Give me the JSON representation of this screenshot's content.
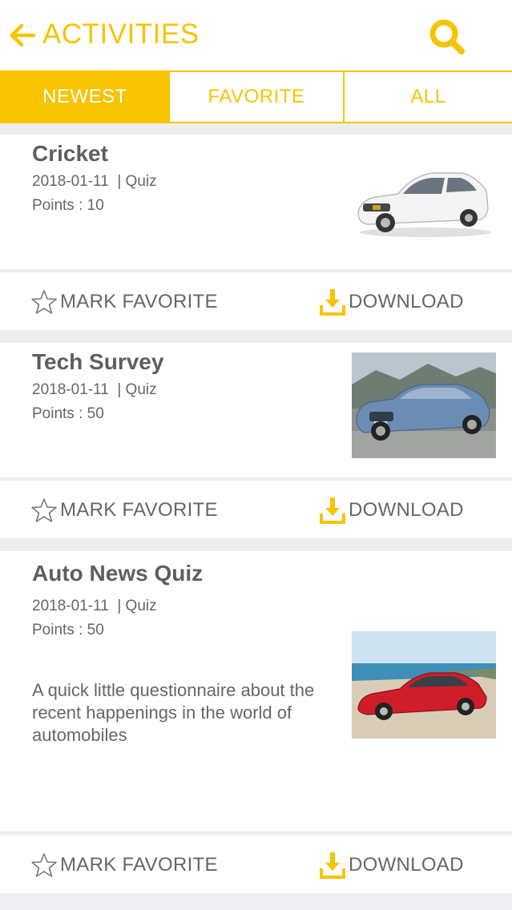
{
  "header": {
    "title": "ACTIVITIES",
    "back_icon": "arrow-left-icon",
    "search_icon": "search-icon",
    "accent": "#f6c400"
  },
  "tabs": [
    {
      "label": "NEWEST",
      "active": true
    },
    {
      "label": "FAVORITE",
      "active": false
    },
    {
      "label": "ALL",
      "active": false
    }
  ],
  "activities": [
    {
      "title": "Cricket",
      "date": "2018-01-11",
      "type": "| Quiz",
      "points": "Points : 10",
      "image": "white-sedan-car"
    },
    {
      "title": "Tech Survey",
      "date": "2018-01-11",
      "type": "| Quiz",
      "points": "Points : 50",
      "image": "blue-convertible-car"
    },
    {
      "title": "Auto News Quiz",
      "date": "2018-01-11",
      "type": "| Quiz",
      "points": "Points : 50",
      "description": "A quick little questionnaire about the recent happenings in the world of automobiles",
      "image": "red-sports-sedan-car"
    }
  ],
  "actions": {
    "favorite_label": "MARK FAVORITE",
    "download_label": "DOWNLOAD",
    "favorite_icon": "star-outline-icon",
    "download_icon": "download-icon"
  }
}
